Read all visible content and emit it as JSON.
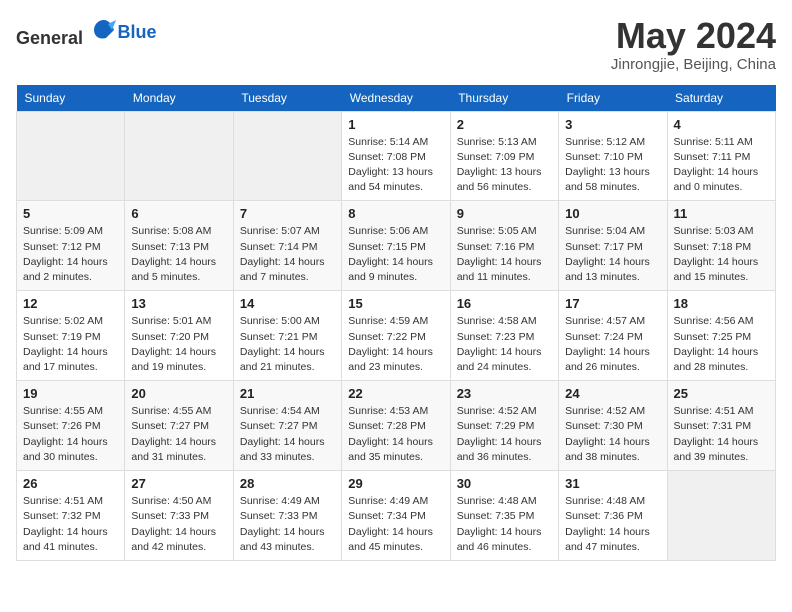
{
  "header": {
    "logo_general": "General",
    "logo_blue": "Blue",
    "month_title": "May 2024",
    "location": "Jinrongjie, Beijing, China"
  },
  "weekdays": [
    "Sunday",
    "Monday",
    "Tuesday",
    "Wednesday",
    "Thursday",
    "Friday",
    "Saturday"
  ],
  "weeks": [
    [
      {
        "day": "",
        "sunrise": "",
        "sunset": "",
        "daylight": ""
      },
      {
        "day": "",
        "sunrise": "",
        "sunset": "",
        "daylight": ""
      },
      {
        "day": "",
        "sunrise": "",
        "sunset": "",
        "daylight": ""
      },
      {
        "day": "1",
        "sunrise": "Sunrise: 5:14 AM",
        "sunset": "Sunset: 7:08 PM",
        "daylight": "Daylight: 13 hours and 54 minutes."
      },
      {
        "day": "2",
        "sunrise": "Sunrise: 5:13 AM",
        "sunset": "Sunset: 7:09 PM",
        "daylight": "Daylight: 13 hours and 56 minutes."
      },
      {
        "day": "3",
        "sunrise": "Sunrise: 5:12 AM",
        "sunset": "Sunset: 7:10 PM",
        "daylight": "Daylight: 13 hours and 58 minutes."
      },
      {
        "day": "4",
        "sunrise": "Sunrise: 5:11 AM",
        "sunset": "Sunset: 7:11 PM",
        "daylight": "Daylight: 14 hours and 0 minutes."
      }
    ],
    [
      {
        "day": "5",
        "sunrise": "Sunrise: 5:09 AM",
        "sunset": "Sunset: 7:12 PM",
        "daylight": "Daylight: 14 hours and 2 minutes."
      },
      {
        "day": "6",
        "sunrise": "Sunrise: 5:08 AM",
        "sunset": "Sunset: 7:13 PM",
        "daylight": "Daylight: 14 hours and 5 minutes."
      },
      {
        "day": "7",
        "sunrise": "Sunrise: 5:07 AM",
        "sunset": "Sunset: 7:14 PM",
        "daylight": "Daylight: 14 hours and 7 minutes."
      },
      {
        "day": "8",
        "sunrise": "Sunrise: 5:06 AM",
        "sunset": "Sunset: 7:15 PM",
        "daylight": "Daylight: 14 hours and 9 minutes."
      },
      {
        "day": "9",
        "sunrise": "Sunrise: 5:05 AM",
        "sunset": "Sunset: 7:16 PM",
        "daylight": "Daylight: 14 hours and 11 minutes."
      },
      {
        "day": "10",
        "sunrise": "Sunrise: 5:04 AM",
        "sunset": "Sunset: 7:17 PM",
        "daylight": "Daylight: 14 hours and 13 minutes."
      },
      {
        "day": "11",
        "sunrise": "Sunrise: 5:03 AM",
        "sunset": "Sunset: 7:18 PM",
        "daylight": "Daylight: 14 hours and 15 minutes."
      }
    ],
    [
      {
        "day": "12",
        "sunrise": "Sunrise: 5:02 AM",
        "sunset": "Sunset: 7:19 PM",
        "daylight": "Daylight: 14 hours and 17 minutes."
      },
      {
        "day": "13",
        "sunrise": "Sunrise: 5:01 AM",
        "sunset": "Sunset: 7:20 PM",
        "daylight": "Daylight: 14 hours and 19 minutes."
      },
      {
        "day": "14",
        "sunrise": "Sunrise: 5:00 AM",
        "sunset": "Sunset: 7:21 PM",
        "daylight": "Daylight: 14 hours and 21 minutes."
      },
      {
        "day": "15",
        "sunrise": "Sunrise: 4:59 AM",
        "sunset": "Sunset: 7:22 PM",
        "daylight": "Daylight: 14 hours and 23 minutes."
      },
      {
        "day": "16",
        "sunrise": "Sunrise: 4:58 AM",
        "sunset": "Sunset: 7:23 PM",
        "daylight": "Daylight: 14 hours and 24 minutes."
      },
      {
        "day": "17",
        "sunrise": "Sunrise: 4:57 AM",
        "sunset": "Sunset: 7:24 PM",
        "daylight": "Daylight: 14 hours and 26 minutes."
      },
      {
        "day": "18",
        "sunrise": "Sunrise: 4:56 AM",
        "sunset": "Sunset: 7:25 PM",
        "daylight": "Daylight: 14 hours and 28 minutes."
      }
    ],
    [
      {
        "day": "19",
        "sunrise": "Sunrise: 4:55 AM",
        "sunset": "Sunset: 7:26 PM",
        "daylight": "Daylight: 14 hours and 30 minutes."
      },
      {
        "day": "20",
        "sunrise": "Sunrise: 4:55 AM",
        "sunset": "Sunset: 7:27 PM",
        "daylight": "Daylight: 14 hours and 31 minutes."
      },
      {
        "day": "21",
        "sunrise": "Sunrise: 4:54 AM",
        "sunset": "Sunset: 7:27 PM",
        "daylight": "Daylight: 14 hours and 33 minutes."
      },
      {
        "day": "22",
        "sunrise": "Sunrise: 4:53 AM",
        "sunset": "Sunset: 7:28 PM",
        "daylight": "Daylight: 14 hours and 35 minutes."
      },
      {
        "day": "23",
        "sunrise": "Sunrise: 4:52 AM",
        "sunset": "Sunset: 7:29 PM",
        "daylight": "Daylight: 14 hours and 36 minutes."
      },
      {
        "day": "24",
        "sunrise": "Sunrise: 4:52 AM",
        "sunset": "Sunset: 7:30 PM",
        "daylight": "Daylight: 14 hours and 38 minutes."
      },
      {
        "day": "25",
        "sunrise": "Sunrise: 4:51 AM",
        "sunset": "Sunset: 7:31 PM",
        "daylight": "Daylight: 14 hours and 39 minutes."
      }
    ],
    [
      {
        "day": "26",
        "sunrise": "Sunrise: 4:51 AM",
        "sunset": "Sunset: 7:32 PM",
        "daylight": "Daylight: 14 hours and 41 minutes."
      },
      {
        "day": "27",
        "sunrise": "Sunrise: 4:50 AM",
        "sunset": "Sunset: 7:33 PM",
        "daylight": "Daylight: 14 hours and 42 minutes."
      },
      {
        "day": "28",
        "sunrise": "Sunrise: 4:49 AM",
        "sunset": "Sunset: 7:33 PM",
        "daylight": "Daylight: 14 hours and 43 minutes."
      },
      {
        "day": "29",
        "sunrise": "Sunrise: 4:49 AM",
        "sunset": "Sunset: 7:34 PM",
        "daylight": "Daylight: 14 hours and 45 minutes."
      },
      {
        "day": "30",
        "sunrise": "Sunrise: 4:48 AM",
        "sunset": "Sunset: 7:35 PM",
        "daylight": "Daylight: 14 hours and 46 minutes."
      },
      {
        "day": "31",
        "sunrise": "Sunrise: 4:48 AM",
        "sunset": "Sunset: 7:36 PM",
        "daylight": "Daylight: 14 hours and 47 minutes."
      },
      {
        "day": "",
        "sunrise": "",
        "sunset": "",
        "daylight": ""
      }
    ]
  ]
}
